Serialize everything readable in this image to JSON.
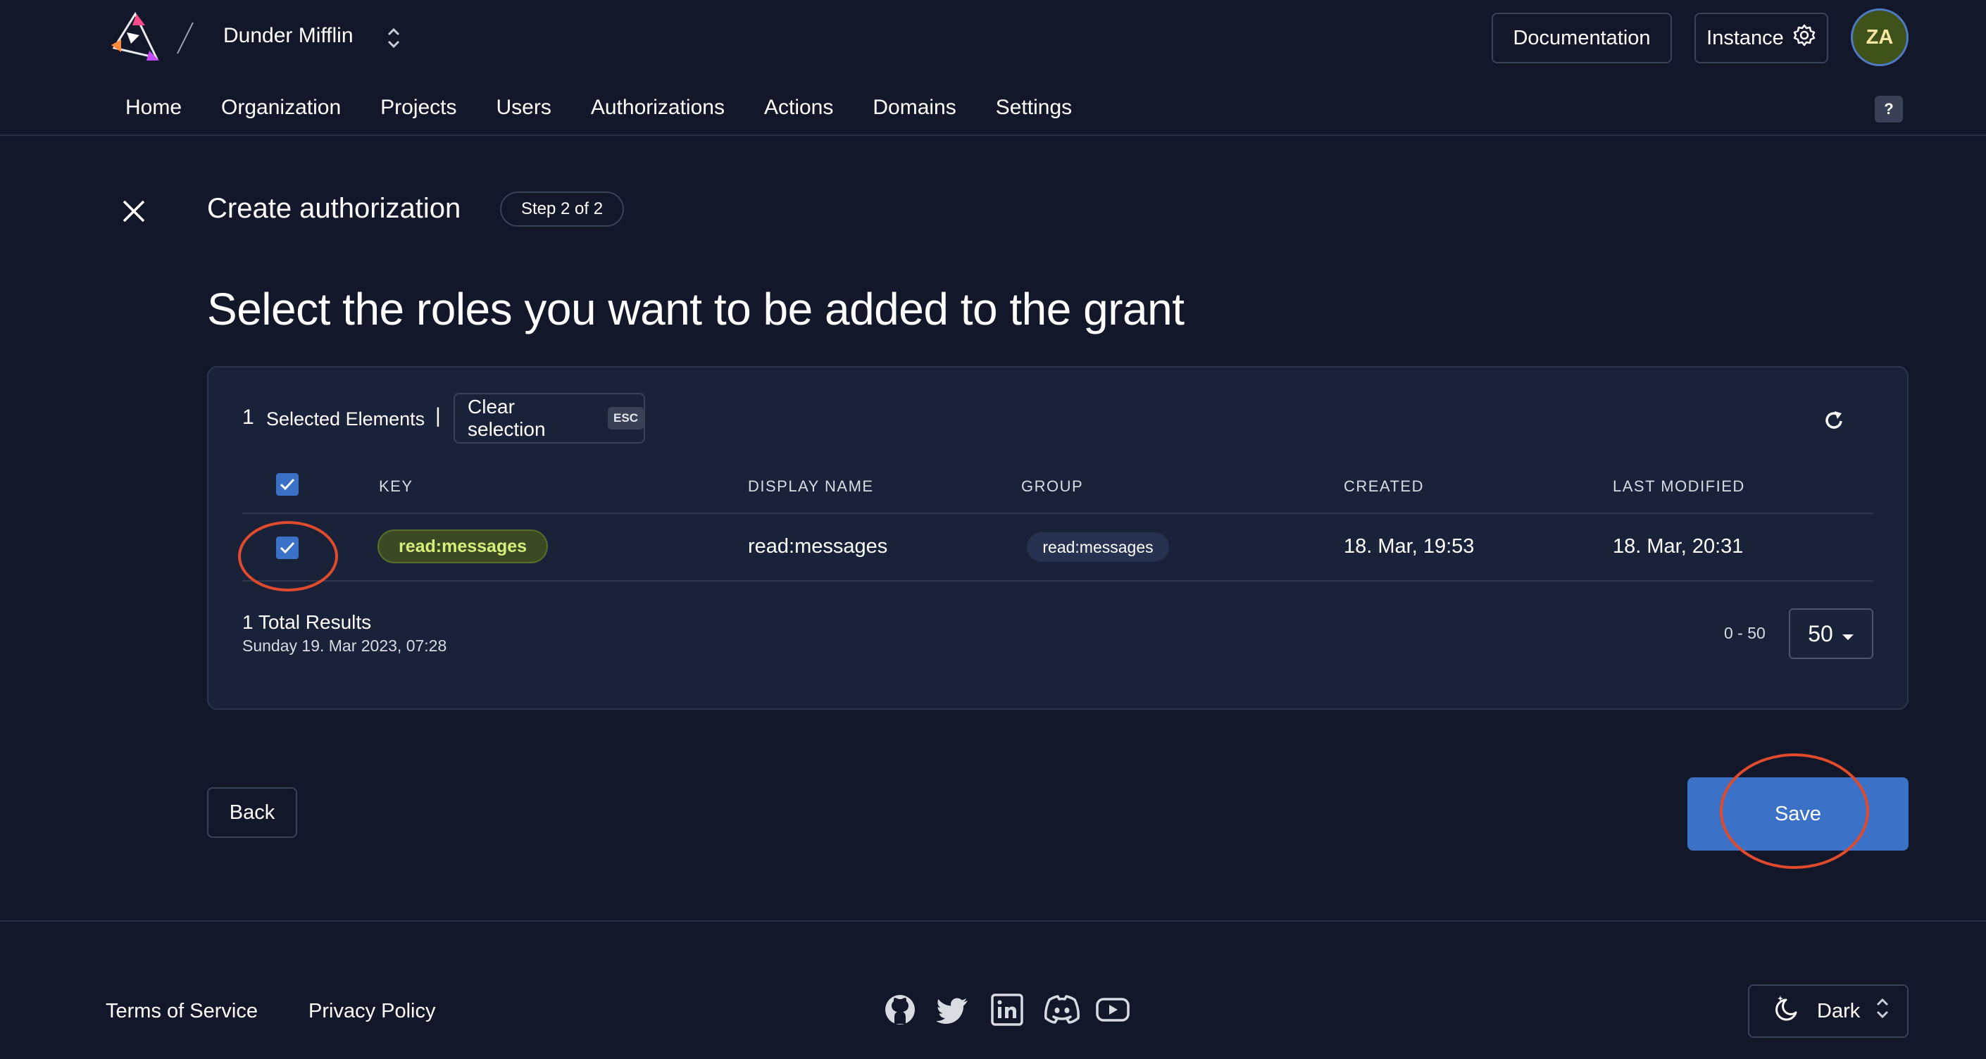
{
  "header": {
    "org_name": "Dunder Mifflin",
    "documentation_label": "Documentation",
    "instance_label": "Instance",
    "avatar_initials": "ZA",
    "help_label": "?"
  },
  "nav": {
    "items": [
      "Home",
      "Organization",
      "Projects",
      "Users",
      "Authorizations",
      "Actions",
      "Domains",
      "Settings"
    ]
  },
  "page": {
    "title": "Create authorization",
    "step": "Step 2 of 2",
    "heading": "Select the roles you want to be added to the grant"
  },
  "selection": {
    "count": "1",
    "label": "Selected Elements",
    "separator": "|",
    "clear_label": "Clear selection",
    "esc_key": "ESC"
  },
  "table": {
    "columns": [
      "KEY",
      "DISPLAY NAME",
      "GROUP",
      "CREATED",
      "LAST MODIFIED"
    ],
    "rows": [
      {
        "selected": true,
        "key": "read:messages",
        "display_name": "read:messages",
        "group": "read:messages",
        "created": "18. Mar, 19:53",
        "last_modified": "18. Mar, 20:31"
      }
    ]
  },
  "pagination": {
    "total": "1 Total Results",
    "timestamp": "Sunday 19. Mar 2023, 07:28",
    "range": "0 - 50",
    "page_size": "50"
  },
  "actions": {
    "back_label": "Back",
    "save_label": "Save"
  },
  "footer": {
    "terms": "Terms of Service",
    "privacy": "Privacy Policy",
    "social_icons": [
      "github-icon",
      "twitter-icon",
      "linkedin-icon",
      "discord-icon",
      "youtube-icon"
    ],
    "theme_label": "Dark"
  },
  "colors": {
    "background": "#121829",
    "card": "#1a2239",
    "accent": "#3b72c8",
    "annotation": "#e04a2d",
    "key_chip_text": "#d5ef7a"
  }
}
